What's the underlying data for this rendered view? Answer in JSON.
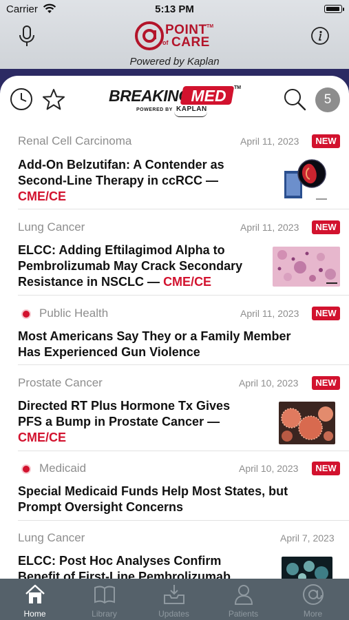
{
  "status_bar": {
    "carrier": "Carrier",
    "time": "5:13 PM"
  },
  "app_header": {
    "brand_top": "POINT",
    "brand_of": "of",
    "brand_bottom": "CARE",
    "brand_tm": "TM",
    "powered_by": "Powered by Kaplan",
    "mic_icon": "microphone-icon",
    "info_icon": "info-icon"
  },
  "breaking_med": {
    "logo_breaking": "BREAKING",
    "logo_med": "MED",
    "logo_tm": "TM",
    "logo_powered": "POWERED BY",
    "logo_kaplan": "KAPLAN",
    "history_icon": "clock-icon",
    "favorites_icon": "star-icon",
    "search_icon": "search-icon",
    "count": "5"
  },
  "articles": [
    {
      "category": "Renal Cell Carcinoma",
      "date": "April 11, 2023",
      "badge": "NEW",
      "headline_lines": [
        "Add-On Belzutifan: A Contender as",
        "Second-Line Therapy in ccRCC —"
      ],
      "cme": "CME/CE",
      "flagged": false,
      "thumbnail": "kidney-illustration"
    },
    {
      "category": "Lung Cancer",
      "date": "April 11, 2023",
      "badge": "NEW",
      "headline_lines": [
        "ELCC: Adding Eftilagimod Alpha to",
        "Pembrolizumab May Crack Secondary",
        "Resistance in NSCLC — "
      ],
      "cme": "CME/CE",
      "flagged": false,
      "thumbnail": "histology-slide"
    },
    {
      "category": "Public Health",
      "date": "April 11, 2023",
      "badge": "NEW",
      "headline_lines": [
        "Most Americans Say They or a Family Member",
        "Has Experienced Gun Violence"
      ],
      "cme": "",
      "flagged": true,
      "thumbnail": ""
    },
    {
      "category": "Prostate Cancer",
      "date": "April 10, 2023",
      "badge": "NEW",
      "headline_lines": [
        "Directed RT Plus Hormone Tx Gives",
        "PFS a Bump in Prostate Cancer —"
      ],
      "cme": "CME/CE",
      "flagged": false,
      "thumbnail": "cancer-cells"
    },
    {
      "category": "Medicaid",
      "date": "April 10, 2023",
      "badge": "NEW",
      "headline_lines": [
        "Special Medicaid Funds Help Most States, but",
        "Prompt Oversight Concerns"
      ],
      "cme": "",
      "flagged": true,
      "thumbnail": ""
    },
    {
      "category": "Lung Cancer",
      "date": "April 7, 2023",
      "badge": "",
      "headline_lines": [
        "ELCC: Post Hoc Analyses Confirm",
        "Benefit of First-Line Pembrolizumab"
      ],
      "cme": "",
      "flagged": false,
      "thumbnail": "micrograph"
    }
  ],
  "tab_bar": {
    "tabs": [
      {
        "label": "Home",
        "icon": "home-icon",
        "active": true
      },
      {
        "label": "Library",
        "icon": "book-icon",
        "active": false
      },
      {
        "label": "Updates",
        "icon": "inbox-download-icon",
        "active": false
      },
      {
        "label": "Patients",
        "icon": "person-icon",
        "active": false
      },
      {
        "label": "More",
        "icon": "at-sign-icon",
        "active": false
      }
    ]
  },
  "colors": {
    "accent_red": "#d2122e",
    "navy": "#2c2a63",
    "tabbar": "#55616a",
    "muted_text": "#8e8e8e"
  }
}
